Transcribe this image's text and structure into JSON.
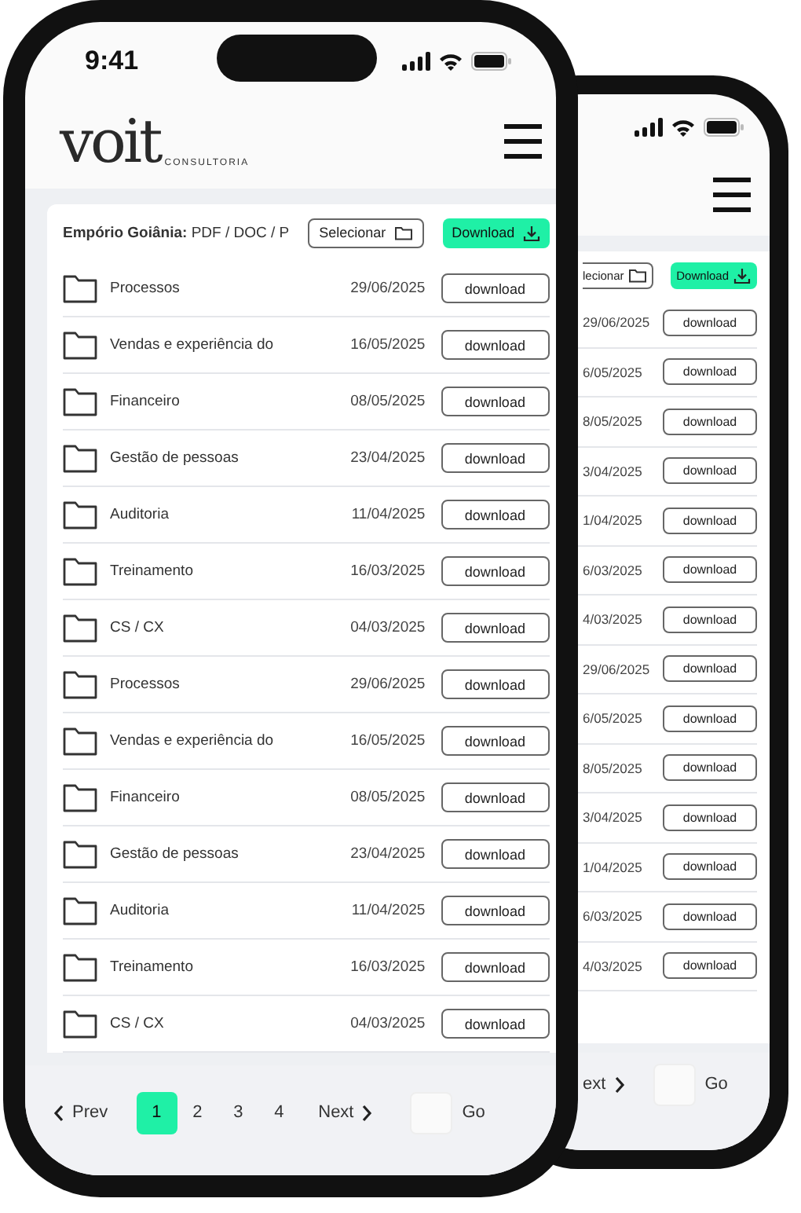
{
  "back_phone": {
    "toolbar": {
      "select_button": "lecionar",
      "download_button": "Download"
    },
    "rows": [
      {
        "date": "29/06/2025",
        "button": "download"
      },
      {
        "date": "6/05/2025",
        "button": "download"
      },
      {
        "date": "8/05/2025",
        "button": "download"
      },
      {
        "date": "3/04/2025",
        "button": "download"
      },
      {
        "date": "1/04/2025",
        "button": "download"
      },
      {
        "date": "6/03/2025",
        "button": "download"
      },
      {
        "date": "4/03/2025",
        "button": "download"
      },
      {
        "date": "29/06/2025",
        "button": "download"
      },
      {
        "date": "6/05/2025",
        "button": "download"
      },
      {
        "date": "8/05/2025",
        "button": "download"
      },
      {
        "date": "3/04/2025",
        "button": "download"
      },
      {
        "date": "1/04/2025",
        "button": "download"
      },
      {
        "date": "6/03/2025",
        "button": "download"
      },
      {
        "date": "4/03/2025",
        "button": "download"
      }
    ],
    "pagination": {
      "next": "ext",
      "go": "Go"
    }
  },
  "front_phone": {
    "status_bar": {
      "time": "9:41"
    },
    "header": {
      "logo": "voit",
      "logo_sub": "CONSULTORIA"
    },
    "toolbar": {
      "title_bold": "Empório Goiânia:",
      "title_rest": "PDF / DOC / P",
      "select_button": "Selecionar",
      "download_button": "Download"
    },
    "rows": [
      {
        "name": "Processos",
        "date": "29/06/2025",
        "button": "download"
      },
      {
        "name": "Vendas e experiência do",
        "date": "16/05/2025",
        "button": "download"
      },
      {
        "name": "Financeiro",
        "date": "08/05/2025",
        "button": "download"
      },
      {
        "name": "Gestão de pessoas",
        "date": "23/04/2025",
        "button": "download"
      },
      {
        "name": "Auditoria",
        "date": "11/04/2025",
        "button": "download"
      },
      {
        "name": "Treinamento",
        "date": "16/03/2025",
        "button": "download"
      },
      {
        "name": "CS / CX",
        "date": "04/03/2025",
        "button": "download"
      },
      {
        "name": "Processos",
        "date": "29/06/2025",
        "button": "download"
      },
      {
        "name": "Vendas e experiência do",
        "date": "16/05/2025",
        "button": "download"
      },
      {
        "name": "Financeiro",
        "date": "08/05/2025",
        "button": "download"
      },
      {
        "name": "Gestão de pessoas",
        "date": "23/04/2025",
        "button": "download"
      },
      {
        "name": "Auditoria",
        "date": "11/04/2025",
        "button": "download"
      },
      {
        "name": "Treinamento",
        "date": "16/03/2025",
        "button": "download"
      },
      {
        "name": "CS / CX",
        "date": "04/03/2025",
        "button": "download"
      }
    ],
    "pagination": {
      "prev": "Prev",
      "pages": [
        {
          "label": "1",
          "selected": true
        },
        {
          "label": "2",
          "selected": false
        },
        {
          "label": "3",
          "selected": false
        },
        {
          "label": "4",
          "selected": false
        }
      ],
      "next": "Next",
      "go": "Go"
    }
  }
}
